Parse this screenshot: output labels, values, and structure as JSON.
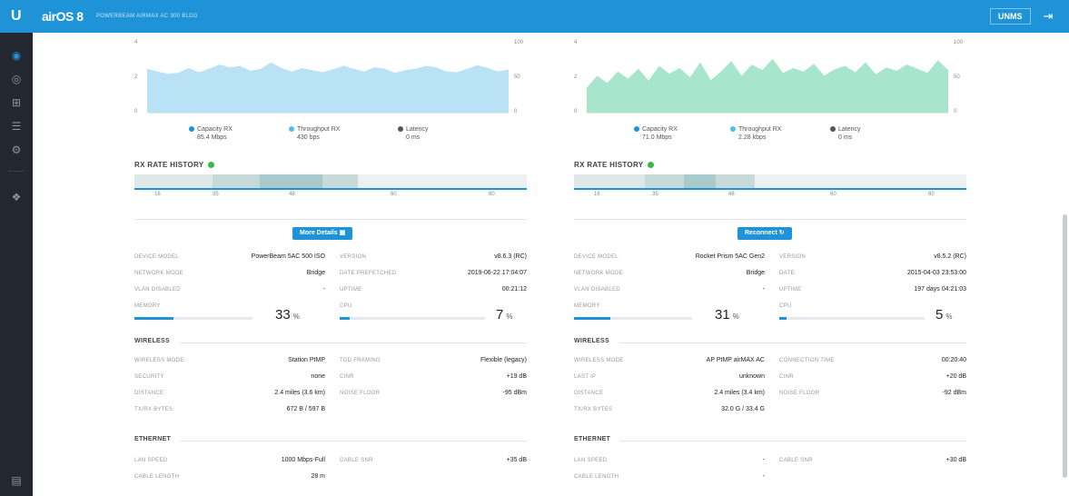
{
  "header": {
    "brand_mark": "U",
    "brand_name": "airOS 8",
    "subtitle": "POWERBEAM AIRMAX AC 300 BLDG",
    "units_label": "UNMS",
    "logout_icon": "logout-icon"
  },
  "sidebar": {
    "items": [
      {
        "icon": "dashboard-icon",
        "active": true
      },
      {
        "icon": "wireless-icon"
      },
      {
        "icon": "network-icon"
      },
      {
        "icon": "services-icon"
      },
      {
        "icon": "settings-icon"
      },
      {
        "icon": "tools-icon"
      }
    ],
    "bottom_icon": "log-icon"
  },
  "left": {
    "chart": {
      "y_ticks_left": [
        "4",
        "2",
        "0"
      ],
      "y_ticks_right": [
        "100",
        "50",
        "0"
      ],
      "fill_color": "#b9e3f4",
      "values": [
        0.62,
        0.58,
        0.55,
        0.56,
        0.63,
        0.57,
        0.62,
        0.68,
        0.64,
        0.66,
        0.59,
        0.62,
        0.71,
        0.63,
        0.58,
        0.63,
        0.6,
        0.57,
        0.61,
        0.66,
        0.62,
        0.58,
        0.64,
        0.62,
        0.56,
        0.6,
        0.62,
        0.66,
        0.64,
        0.58,
        0.57,
        0.62,
        0.67,
        0.63,
        0.58,
        0.61
      ]
    },
    "legend": [
      {
        "label": "Capacity RX",
        "value": "85.4 Mbps",
        "color": "#1f93d7"
      },
      {
        "label": "Throughput RX",
        "value": "430 bps",
        "color": "#4fc0e8"
      },
      {
        "label": "Latency",
        "value": "0 ms",
        "color": "#555555"
      }
    ],
    "rx_title": "RX RATE HISTORY",
    "rx_axis": [
      "16",
      "35",
      "48",
      "60",
      "80"
    ],
    "rx_segments": [
      {
        "color": "#dfe7e9",
        "w": 0.2
      },
      {
        "color": "#c7d9d9",
        "w": 0.12
      },
      {
        "color": "#a9c9cb",
        "w": 0.16
      },
      {
        "color": "#c7d9d9",
        "w": 0.09
      },
      {
        "color": "#eef1f2",
        "w": 0.43
      }
    ],
    "button": "More Details",
    "device": {
      "device_model_label": "DEVICE MODEL",
      "device_model": "PowerBeam 5AC 500 ISO",
      "version_label": "VERSION",
      "version": "v8.6.3 (RC)",
      "network_mode_label": "NETWORK MODE",
      "network_mode": "Bridge",
      "date_label": "DATE PREFETCHED",
      "date": "2019-06-22 17:04:07",
      "vlan_label": "VLAN DISABLED",
      "vlan": "-",
      "uptime_label": "UPTIME",
      "uptime": "00:21:12",
      "memory_label": "MEMORY",
      "memory": "33",
      "memory_unit": "%",
      "memory_fraction": 0.33,
      "cpu_label": "CPU",
      "cpu": "7",
      "cpu_unit": "%",
      "cpu_fraction": 0.07
    },
    "wireless": {
      "title": "WIRELESS",
      "mode_label": "WIRELESS MODE",
      "mode": "Station PtMP",
      "legacy_label": "TDD FRAMING",
      "legacy": "Flexible (legacy)",
      "security_label": "SECURITY",
      "security": "none",
      "cinr_label": "CINR",
      "cinr": "+19 dB",
      "distance_label": "DISTANCE",
      "distance": "2.4 miles (3.6 km)",
      "noise_label": "NOISE FLOOR",
      "noise": "-95 dBm",
      "tx_label": "TX/RX BYTES",
      "tx": "672 B / 597 B"
    },
    "ethernet": {
      "title": "ETHERNET",
      "lan_label": "LAN SPEED",
      "lan": "1000 Mbps-Full",
      "cable_snr_label": "CABLE SNR",
      "cable_snr": "+35 dB",
      "cable_len_label": "CABLE LENGTH",
      "cable_len": "28 m"
    }
  },
  "right": {
    "chart": {
      "y_ticks_left": [
        "4",
        "2",
        "0"
      ],
      "y_ticks_right": [
        "100",
        "50",
        "0"
      ],
      "fill_color": "#a7e5cd",
      "values": [
        0.35,
        0.52,
        0.42,
        0.58,
        0.48,
        0.62,
        0.45,
        0.66,
        0.55,
        0.63,
        0.5,
        0.71,
        0.46,
        0.58,
        0.73,
        0.52,
        0.68,
        0.6,
        0.76,
        0.56,
        0.63,
        0.58,
        0.69,
        0.52,
        0.61,
        0.66,
        0.57,
        0.71,
        0.54,
        0.64,
        0.59,
        0.68,
        0.62,
        0.56,
        0.74,
        0.6
      ]
    },
    "legend": [
      {
        "label": "Capacity RX",
        "value": "71.0 Mbps",
        "color": "#1f93d7"
      },
      {
        "label": "Throughput RX",
        "value": "2.28 kbps",
        "color": "#4fc0e8"
      },
      {
        "label": "Latency",
        "value": "0 ms",
        "color": "#555555"
      }
    ],
    "rx_title": "RX RATE HISTORY",
    "rx_axis": [
      "16",
      "35",
      "48",
      "60",
      "80"
    ],
    "rx_segments": [
      {
        "color": "#dfe7e9",
        "w": 0.18
      },
      {
        "color": "#c7d9d9",
        "w": 0.1
      },
      {
        "color": "#a9c9cb",
        "w": 0.08
      },
      {
        "color": "#c7d9d9",
        "w": 0.1
      },
      {
        "color": "#eef1f2",
        "w": 0.54
      }
    ],
    "button": "Reconnect",
    "device": {
      "device_model_label": "DEVICE MODEL",
      "device_model": "Rocket Prism 5AC Gen2",
      "version_label": "VERSION",
      "version": "v8.5.2 (RC)",
      "network_mode_label": "NETWORK MODE",
      "network_mode": "Bridge",
      "date_label": "DATE",
      "date": "2015-04-03 23:53:00",
      "vlan_label": "VLAN DISABLED",
      "vlan": "-",
      "uptime_label": "UPTIME",
      "uptime": "197 days 04:21:03",
      "memory_label": "MEMORY",
      "memory": "31",
      "memory_unit": "%",
      "memory_fraction": 0.31,
      "cpu_label": "CPU",
      "cpu": "5",
      "cpu_unit": "%",
      "cpu_fraction": 0.05
    },
    "wireless": {
      "title": "WIRELESS",
      "mode_label": "WIRELESS MODE",
      "mode": "AP PtMP airMAX AC",
      "legacy_label": "CONNECTION TIME",
      "legacy": "00:20:40",
      "security_label": "LAST IP",
      "security": "unknown",
      "cinr_label": "CINR",
      "cinr": "+20 dB",
      "distance_label": "DISTANCE",
      "distance": "2.4 miles (3.4 km)",
      "noise_label": "NOISE FLOOR",
      "noise": "-92 dBm",
      "tx_label": "TX/RX BYTES",
      "tx": "32.0 G / 33.4 G"
    },
    "ethernet": {
      "title": "ETHERNET",
      "lan_label": "LAN SPEED",
      "lan": "-",
      "cable_snr_label": "CABLE SNR",
      "cable_snr": "+30 dB",
      "cable_len_label": "CABLE LENGTH",
      "cable_len": "-"
    }
  }
}
